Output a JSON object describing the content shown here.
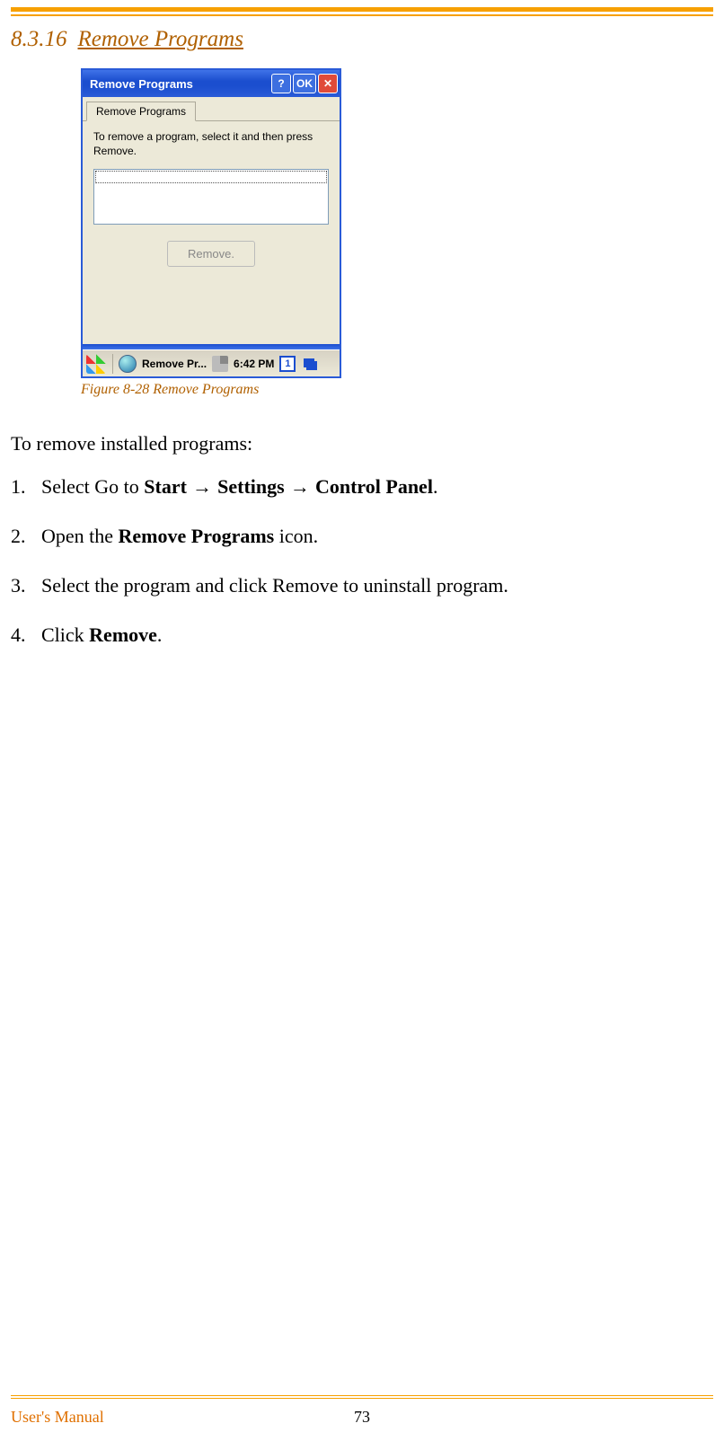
{
  "heading": {
    "number": "8.3.16",
    "title": "Remove Programs"
  },
  "screenshot": {
    "titlebar": {
      "title": "Remove Programs",
      "help": "?",
      "ok": "OK",
      "close": "✕"
    },
    "tab": "Remove Programs",
    "panel_text": "To remove a program, select it and then press Remove.",
    "remove_button": "Remove.",
    "taskbar": {
      "app": "Remove Pr...",
      "time": "6:42 PM",
      "indicator": "1"
    }
  },
  "caption": "Figure 8-28 Remove Programs",
  "intro": "To remove installed programs:",
  "steps": [
    {
      "n": "1.",
      "pre": "Select Go to ",
      "b1": "Start",
      "mid1": "  → ",
      "b2": "Settings",
      "mid2": "  → ",
      "b3": "Control Panel",
      "post": "."
    },
    {
      "n": "2.",
      "pre": "Open the ",
      "b1": "Remove Programs",
      "post": " icon."
    },
    {
      "n": "3.",
      "plain": "Select the program and click Remove to uninstall program."
    },
    {
      "n": "4.",
      "pre": "Click ",
      "b1": "Remove",
      "post": "."
    }
  ],
  "footer": {
    "left": "User's Manual",
    "page": "73"
  }
}
